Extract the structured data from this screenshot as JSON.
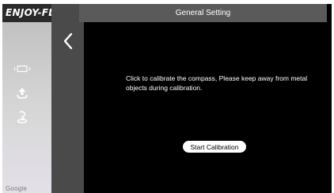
{
  "brand": {
    "name": "ENJOY-FL"
  },
  "sidebar": {
    "icons": [
      {
        "name": "battery-frame-icon"
      },
      {
        "name": "takeoff-icon"
      },
      {
        "name": "return-home-icon"
      }
    ],
    "map_attribution": "Google"
  },
  "header": {
    "title": "General Setting"
  },
  "back": {
    "icon": "chevron-left-icon"
  },
  "main": {
    "message": "Click to calibrate the compass, Please keep away from metal objects during calibration.",
    "start_button_label": "Start Calibration"
  },
  "colors": {
    "background": "#000000",
    "title_bar": "#5a5a5a",
    "back_column": "#4a4a4a",
    "brand_bar": "#2a2a2a",
    "button": "#ffffff",
    "text": "#ffffff"
  }
}
